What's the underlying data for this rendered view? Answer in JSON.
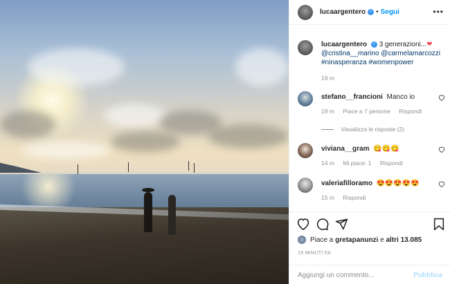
{
  "post": {
    "author": "lucaargentero",
    "dot": "•",
    "follow_label": "Segui",
    "more_label": "•••",
    "verified_mark": "✓"
  },
  "caption": {
    "username": "lucaargentero",
    "text": "3 generazioni...",
    "heart": "❤",
    "tags_line1": "@cristina__marino @carmelamarcozzi",
    "tags_line2": "#ninasperanza #womenpower",
    "time": "19 m"
  },
  "comments": [
    {
      "username": "stefano__francioni",
      "text": "Manco io",
      "time": "19 m",
      "likes": "Piace a 7 persone",
      "reply": "Rispondi",
      "view_replies": "Visualizza le risposte (2)"
    },
    {
      "username": "viviana__gram",
      "text": "😋😋😋",
      "time": "14 m",
      "likes": "Mi piace: 1",
      "reply": "Rispondi"
    },
    {
      "username": "valeriafilloramo",
      "text": "😍😍😍😍😍",
      "time": "15 m",
      "reply": "Rispondi"
    }
  ],
  "likes_summary": {
    "prefix": "Piace a",
    "user": "gretapanunzi",
    "middle": "e",
    "others": "altri 13.085"
  },
  "posted_time": "19 MINUTI FA",
  "add_comment": {
    "placeholder": "Aggiungi un commento...",
    "publish_label": "Pubblica"
  },
  "colors": {
    "link_blue": "#0095f6",
    "verified_blue": "#3897f0",
    "heart_red": "#ed4956",
    "muted_gray": "#8e8e8e"
  },
  "icons": [
    "heart-icon",
    "comment-icon",
    "share-icon",
    "bookmark-icon",
    "like-icon",
    "more-icon",
    "verified-icon"
  ]
}
